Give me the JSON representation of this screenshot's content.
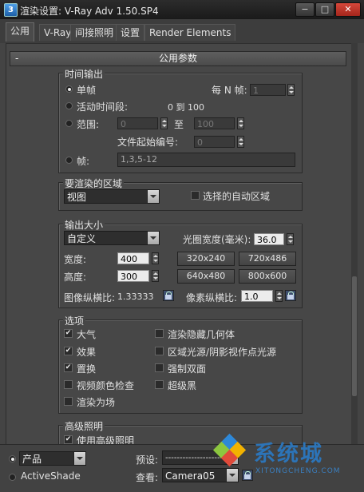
{
  "window": {
    "icon": "3ds-max-icon",
    "title": "渲染设置: V-Ray Adv 1.50.SP4",
    "min": "−",
    "max": "□",
    "close": "✕"
  },
  "tabs": [
    "公用",
    "V-Ray",
    "间接照明",
    "设置",
    "Render Elements"
  ],
  "rollout": {
    "toggle": "-",
    "title": "公用参数"
  },
  "time_output": {
    "title": "时间输出",
    "single": "单帧",
    "every_n_label": "每 N 帧:",
    "every_n_value": "1",
    "active_segment": "活动时间段:",
    "active_range": "0 到 100",
    "range": "范围:",
    "range_from": "0",
    "range_to_label": "至",
    "range_to": "100",
    "file_start_label": "文件起始编号:",
    "file_start": "0",
    "frames": "帧:",
    "frames_value": "1,3,5-12"
  },
  "area": {
    "title": "要渲染的区域",
    "selected": "视图",
    "auto_region": "选择的自动区域"
  },
  "output_size": {
    "title": "输出大小",
    "preset": "自定义",
    "aperture_label": "光圈宽度(毫米):",
    "aperture": "36.0",
    "width_label": "宽度:",
    "width": "400",
    "height_label": "高度:",
    "height": "300",
    "presets": [
      "320x240",
      "720x486",
      "640x480",
      "800x600"
    ],
    "image_aspect_label": "图像纵横比:",
    "image_aspect": "1.33333",
    "pixel_aspect_label": "像素纵横比:",
    "pixel_aspect": "1.0"
  },
  "options": {
    "title": "选项",
    "left": [
      {
        "label": "大气",
        "checked": true
      },
      {
        "label": "效果",
        "checked": true
      },
      {
        "label": "置换",
        "checked": true
      },
      {
        "label": "视频颜色检查",
        "checked": false
      },
      {
        "label": "渲染为场",
        "checked": false
      }
    ],
    "right": [
      {
        "label": "渲染隐藏几何体",
        "checked": false
      },
      {
        "label": "区域光源/阴影视作点光源",
        "checked": false
      },
      {
        "label": "强制双面",
        "checked": false
      },
      {
        "label": "超级黑",
        "checked": false
      }
    ],
    "check_mark": "✔"
  },
  "advanced_lighting": {
    "title": "高级照明",
    "use": "使用高级照明"
  },
  "bottom": {
    "product": "产品",
    "activeshade": "ActiveShade",
    "preset_label": "预设:",
    "preset_value": "-----------------------",
    "view_label": "查看:",
    "view_value": "Camera05"
  },
  "watermark": {
    "brand": "系统城",
    "url": "XITONGCHENG.COM"
  },
  "colors": {
    "bg": "#474747",
    "titlebar": "#1a1a1a",
    "close": "#c03a2e",
    "watermark_text": "#2c74b8"
  }
}
